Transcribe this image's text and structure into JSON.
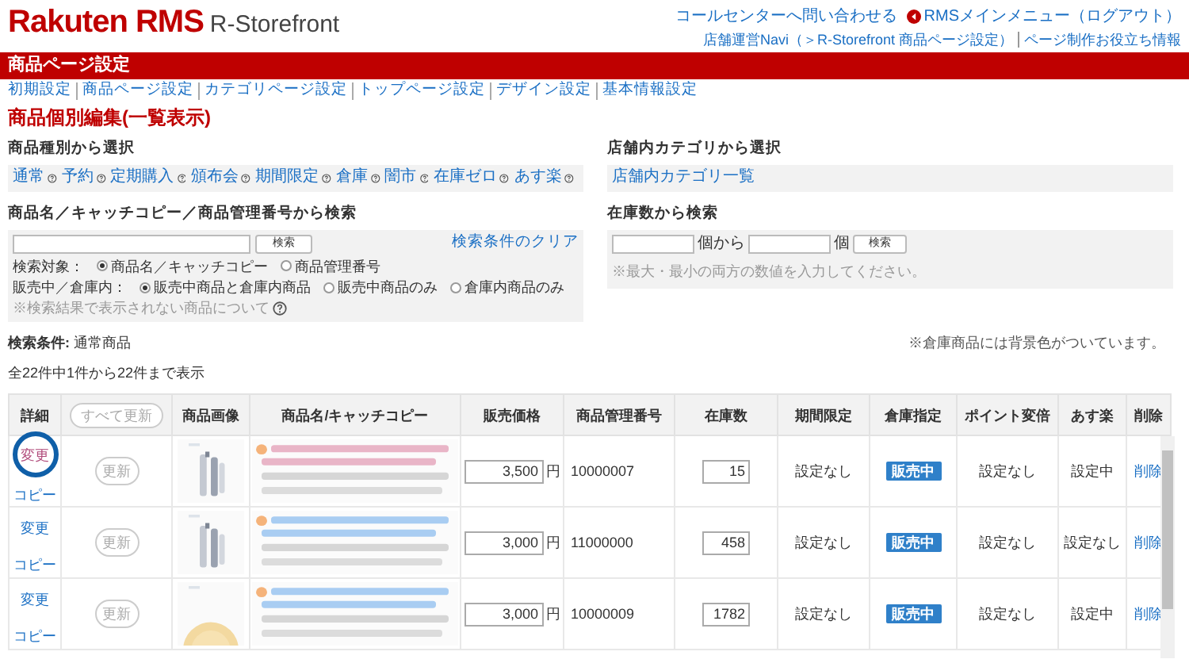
{
  "header": {
    "brand": "Rakuten",
    "brand2": "RMS",
    "product": "R-Storefront",
    "links": [
      {
        "text": "コールセンターへ問い合わせる",
        "kind": "plain"
      },
      {
        "text": "RMSメインメニュー（ログアウト）",
        "kind": "back"
      }
    ],
    "links2": [
      "店舗運営Navi（＞R-Storefront 商品ページ設定）",
      "ページ制作お役立ち情報"
    ]
  },
  "title_bar": "商品ページ設定",
  "nav": [
    "初期設定",
    "商品ページ設定",
    "カテゴリページ設定",
    "トップページ設定",
    "デザイン設定",
    "基本情報設定"
  ],
  "page_heading": "商品個別編集(一覧表示)",
  "type_filter": {
    "label": "商品種別から選択",
    "links": [
      "通常",
      "予約",
      "定期購入",
      "頒布会",
      "期間限定",
      "倉庫",
      "闇市",
      "在庫ゼロ",
      "あす楽"
    ]
  },
  "category_filter": {
    "label": "店舗内カテゴリから選択",
    "link": "店舗内カテゴリ一覧"
  },
  "keyword_search": {
    "label": "商品名／キャッチコピー／商品管理番号から検索",
    "button": "検索",
    "clear": "検索条件のクリア",
    "target": {
      "label": "検索対象：",
      "options": [
        {
          "label": "商品名／キャッチコピー",
          "selected": true
        },
        {
          "label": "商品管理番号",
          "selected": false
        }
      ]
    },
    "status": {
      "label": "販売中／倉庫内：",
      "options": [
        {
          "label": "販売中商品と倉庫内商品",
          "selected": true
        },
        {
          "label": "販売中商品のみ",
          "selected": false
        },
        {
          "label": "倉庫内商品のみ",
          "selected": false
        }
      ]
    },
    "note": "※検索結果で表示されない商品について"
  },
  "stock_search": {
    "label": "在庫数から検索",
    "from_unit": "個から",
    "to_unit": "個",
    "button": "検索",
    "note": "※最大・最小の両方の数値を入力してください。"
  },
  "search_condition": "**検索条件:** 通常商品",
  "warehouse_note": "※倉庫商品には背景色がついています。",
  "result_count": "全22件中1件から22件まで表示",
  "table": {
    "columns": [
      {
        "label": "詳細",
        "kind": "text"
      },
      {
        "label": "すべて更新",
        "kind": "button"
      },
      {
        "label": "商品画像",
        "kind": "text"
      },
      {
        "label": "商品名/キャッチコピー",
        "kind": "text"
      },
      {
        "label": "販売価格",
        "kind": "text"
      },
      {
        "label": "商品管理番号",
        "kind": "text"
      },
      {
        "label": "在庫数",
        "kind": "text"
      },
      {
        "label": "期間限定",
        "kind": "text"
      },
      {
        "label": "倉庫指定",
        "kind": "text"
      },
      {
        "label": "ポイント変倍",
        "kind": "text"
      },
      {
        "label": "あす楽",
        "kind": "text"
      },
      {
        "label": "削除",
        "kind": "text"
      }
    ],
    "rows": [
      {
        "edit": "変更",
        "copy": "コピー",
        "update": "更新",
        "price": "3,500",
        "currency": "円",
        "product_id": "10000007",
        "stock": "15",
        "period": "設定なし",
        "warehouse": "販売中",
        "point": "設定なし",
        "asuraku": "設定中",
        "delete": "削除",
        "highlighted": true
      },
      {
        "edit": "変更",
        "copy": "コピー",
        "update": "更新",
        "price": "3,000",
        "currency": "円",
        "product_id": "11000000",
        "stock": "458",
        "period": "設定なし",
        "warehouse": "販売中",
        "point": "設定なし",
        "asuraku": "設定なし",
        "delete": "削除",
        "highlighted": false
      },
      {
        "edit": "変更",
        "copy": "コピー",
        "update": "更新",
        "price": "3,000",
        "currency": "円",
        "product_id": "10000009",
        "stock": "1782",
        "period": "設定なし",
        "warehouse": "販売中",
        "point": "設定なし",
        "asuraku": "設定中",
        "delete": "削除",
        "highlighted": false
      }
    ]
  }
}
